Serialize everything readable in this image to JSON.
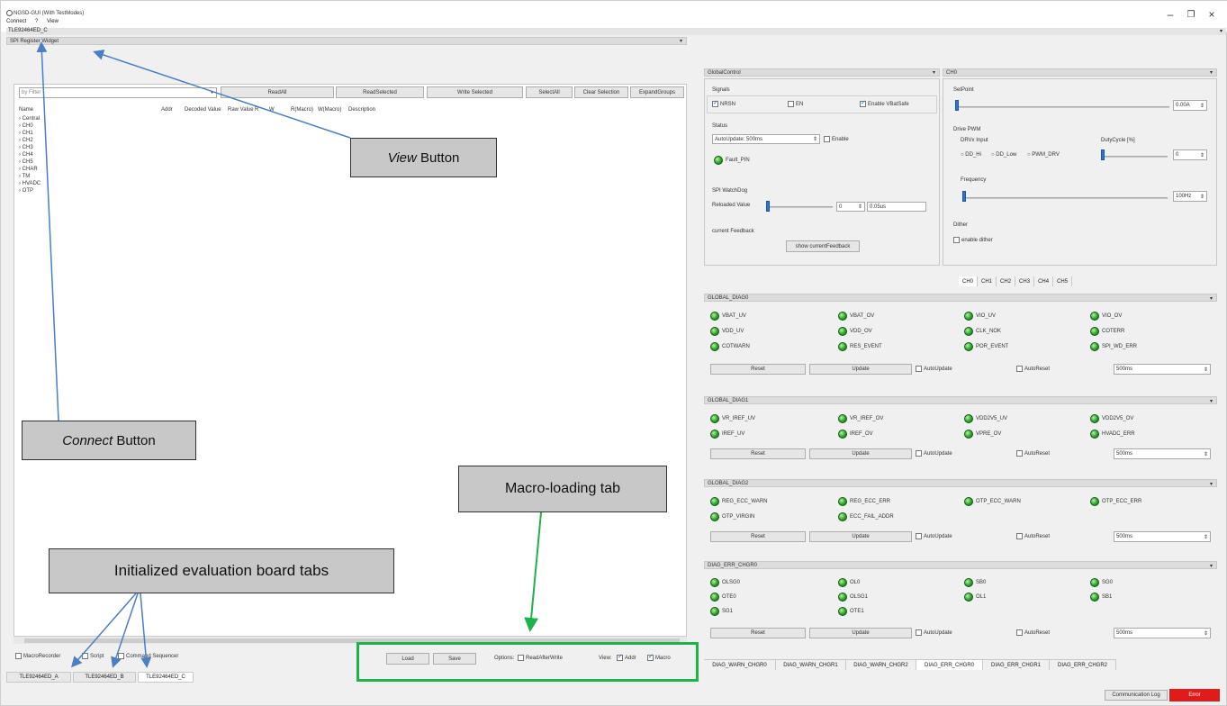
{
  "window": {
    "title": "NGSD-GUI (With TestModes)",
    "minimize": "–",
    "restore": "❐",
    "close": "×"
  },
  "menu": {
    "connect": "Connect",
    "help": "?",
    "view": "View"
  },
  "doc_tab": "TLE92464ED_C",
  "register_widget": {
    "title": "SPI Register Widget",
    "filter_placeholder": "by Filter",
    "buttons": [
      "ReadAll",
      "ReadSelected",
      "Write Selected",
      "SelectAll",
      "Clear Selection",
      "ExpandGroups"
    ],
    "columns": [
      "Name",
      "Addr",
      "Decoded Value",
      "Raw Value",
      "R",
      "W",
      "R(Macro)",
      "W(Macro)",
      "Description"
    ],
    "tree": [
      "Central",
      "CH0",
      "CH1",
      "CH2",
      "CH3",
      "CH4",
      "CH5",
      "CHAR",
      "TM",
      "HVADC",
      "OTP"
    ]
  },
  "bottom_bar": {
    "checkboxes": [
      "MacroRecorder",
      "Script",
      "Command Sequencer"
    ],
    "load": "Load",
    "save": "Save",
    "options_label": "Options:",
    "read_after_write": "ReadAfterWrite",
    "view_label": "View:",
    "addr": "Addr",
    "macro": "Macro"
  },
  "board_tabs": [
    "TLE92464ED_A",
    "TLE92464ED_B",
    "TLE92464ED_C"
  ],
  "global_control": {
    "title": "GlobalControl",
    "signals_label": "Signals",
    "nrsn": "NRSN",
    "en": "EN",
    "enable_vbatsafe": "Enable VBatSafe",
    "status_label": "Status",
    "autoupdate_value": "AutoUpdate: 500ms",
    "enable": "Enable",
    "fault_pin": "Fault_PIN",
    "spi_watchdog": "SPI WatchDog",
    "reloaded_value": "Reloaded Value",
    "wd_value": "0",
    "wd_time": "0.05us",
    "current_feedback": "current Feedback",
    "show_current_feedback": "show currentFeedback"
  },
  "ch0": {
    "title": "CH0",
    "setpoint_label": "SetPoint",
    "setpoint_value": "0.00A",
    "drive_pwm": "Drive PWM",
    "drv_input": "DRVx Input",
    "dutycycle": "DutyCycle [%]",
    "radio_hi": "DD_Hi",
    "radio_low": "DD_Low",
    "radio_pwm": "PWM_DRV",
    "duty_value": "0",
    "frequency": "Frequency",
    "freq_value": "100Hz",
    "dither": "Dither",
    "enable_dither": "enable dither"
  },
  "ch_tabs": [
    "CH0",
    "CH1",
    "CH2",
    "CH3",
    "CH4",
    "CH5"
  ],
  "diag_groups": [
    {
      "title": "GLOBAL_DIAG0",
      "rows": [
        [
          "VBAT_UV",
          "VBAT_OV",
          "VIO_UV",
          "VIO_OV"
        ],
        [
          "VDD_UV",
          "VDD_OV",
          "CLK_NOK",
          "COTERR"
        ],
        [
          "COTWARN",
          "RES_EVENT",
          "POR_EVENT",
          "SPI_WD_ERR"
        ]
      ]
    },
    {
      "title": "GLOBAL_DIAG1",
      "rows": [
        [
          "VR_IREF_UV",
          "VR_IREF_OV",
          "VDD2V5_UV",
          "VDD2V5_OV"
        ],
        [
          "IREF_UV",
          "IREF_OV",
          "VPRE_OV",
          "HVADC_ERR"
        ]
      ]
    },
    {
      "title": "GLOBAL_DIAG2",
      "rows": [
        [
          "REG_ECC_WARN",
          "REG_ECC_ERR",
          "OTP_ECC_WARN",
          "OTP_ECC_ERR"
        ],
        [
          "OTP_VIRGIN",
          "ECC_FAIL_ADDR",
          "",
          ""
        ]
      ]
    },
    {
      "title": "DIAG_ERR_CHGR0",
      "rows": [
        [
          "OLSG0",
          "OL0",
          "SB0",
          "SG0"
        ],
        [
          "OTE0",
          "OLSG1",
          "OL1",
          "SB1"
        ],
        [
          "SG1",
          "OTE1",
          "",
          ""
        ]
      ]
    }
  ],
  "diag_controls": {
    "reset": "Reset",
    "update": "Update",
    "autoupdate": "AutoUpdate",
    "autoreset": "AutoReset",
    "interval": "500ms"
  },
  "bottom_tabs": [
    "DIAG_WARN_CHGR0",
    "DIAG_WARN_CHGR1",
    "DIAG_WARN_CHGR2",
    "DIAG_ERR_CHGR0",
    "DIAG_ERR_CHGR1",
    "DIAG_ERR_CHGR2"
  ],
  "status_bar": {
    "comm_log": "Communication Log",
    "error": "Error"
  },
  "callouts": {
    "view": "View",
    "view_suffix": " Button",
    "connect": "Connect",
    "connect_suffix": " Button",
    "macro": "Macro-loading tab",
    "boards": "Initialized evaluation board tabs"
  },
  "colors": {
    "callout_bg": "#c8c8c8",
    "arrow_blue": "#4a7fc4",
    "arrow_green": "#1db34a",
    "led_green": "#2fa22f",
    "error_red": "#e01b1b"
  }
}
